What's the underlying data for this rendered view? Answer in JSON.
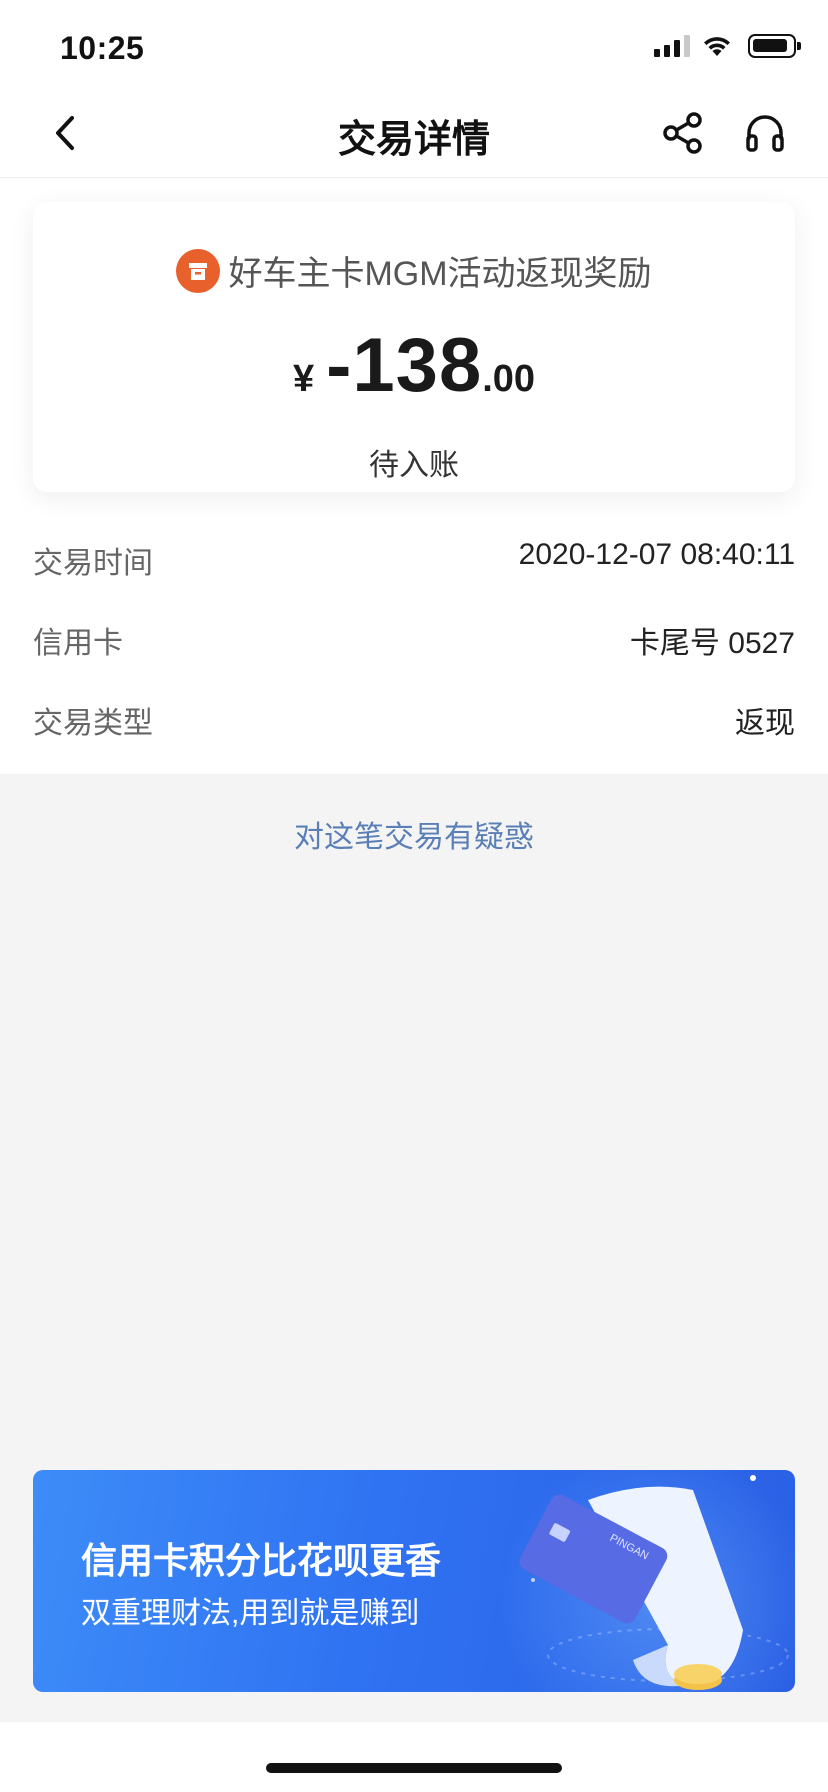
{
  "status_bar": {
    "time": "10:25"
  },
  "nav": {
    "title": "交易详情"
  },
  "summary": {
    "merchant_name": "好车主卡MGM活动返现奖励",
    "currency_symbol": "¥",
    "amount_integer": "-138",
    "amount_decimal": ".00",
    "status": "待入账"
  },
  "details": [
    {
      "label": "交易时间",
      "value": "2020-12-07 08:40:11"
    },
    {
      "label": "信用卡",
      "value": "卡尾号 0527"
    },
    {
      "label": "交易类型",
      "value": "返现"
    }
  ],
  "question_link": "对这笔交易有疑惑",
  "banner": {
    "title": "信用卡积分比花呗更香",
    "subtitle": "双重理财法,用到就是赚到",
    "card_brand": "PINGAN"
  },
  "colors": {
    "merchant_icon": "#e8602c",
    "link": "#5a7fb6",
    "banner_start": "#3d8cf8",
    "banner_end": "#2a5fe4"
  }
}
